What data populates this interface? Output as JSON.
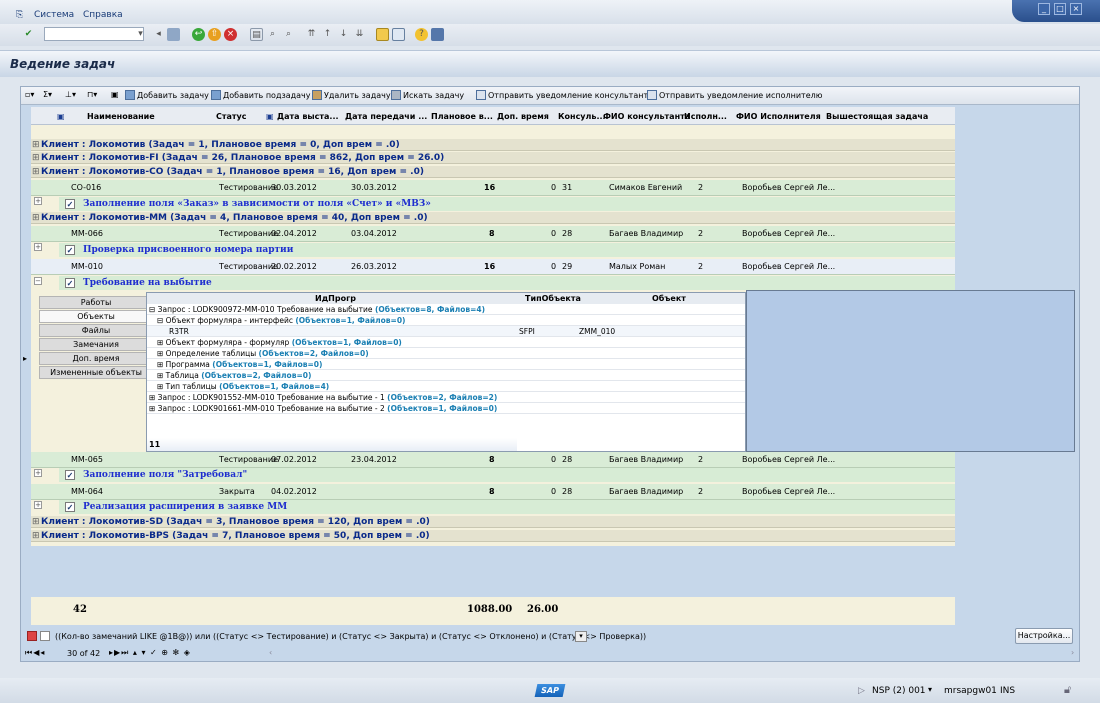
{
  "menu": {
    "items": [
      "Система",
      "Справка"
    ]
  },
  "page_title": "Ведение задач",
  "alv_toolbar": {
    "buttons": [
      "Добавить задачу",
      "Добавить подзадачу",
      "Удалить задачу",
      "Искать задачу",
      "Отправить уведомление консультанту",
      "Отправить уведомление исполнителю"
    ]
  },
  "columns": [
    "Наименование",
    "Статус",
    "Дата выста...",
    "Дата передачи ...",
    "Плановое в...",
    "Доп. время",
    "Консуль...",
    "ФИО консультанта",
    "Исполн...",
    "ФИО Исполнителя",
    "Вышестоящая задача"
  ],
  "groups": [
    "Клиент : Локомотив (Задач = 1, Плановое время = 0, Доп врем = .0)",
    "Клиент : Локомотив-FI (Задач = 26, Плановое время = 862, Доп врем = 26.0)",
    "Клиент : Локомотив-CO (Задач = 1, Плановое время = 16, Доп врем = .0)",
    "Клиент : Локомотив-MM (Задач = 4, Плановое время = 40, Доп врем = .0)",
    "Клиент : Локомотив-SD (Задач = 3, Плановое время = 120, Доп врем = .0)",
    "Клиент : Локомотив-BPS (Задач = 7, Плановое время = 50, Доп врем = .0)"
  ],
  "rows": [
    {
      "id": "CO-016",
      "status": "Тестирование",
      "date1": "30.03.2012",
      "date2": "30.03.2012",
      "plan": "16",
      "extra": "0",
      "cons": "31",
      "cons_name": "Симаков Евгений",
      "exec": "2",
      "exec_name": "Воробьев Сергей Ле...",
      "task": "Заполнение поля «Заказ» в зависимости от поля «Счет» и «МВЗ»"
    },
    {
      "id": "MM-066",
      "status": "Тестирование",
      "date1": "02.04.2012",
      "date2": "03.04.2012",
      "plan": "8",
      "extra": "0",
      "cons": "28",
      "cons_name": "Багаев Владимир",
      "exec": "2",
      "exec_name": "Воробьев Сергей Ле...",
      "task": "Проверка присвоенного номера партии"
    },
    {
      "id": "MM-010",
      "status": "Тестирование",
      "date1": "20.02.2012",
      "date2": "26.03.2012",
      "plan": "16",
      "extra": "0",
      "cons": "29",
      "cons_name": "Малых Роман",
      "exec": "2",
      "exec_name": "Воробьев Сергей Ле...",
      "task": "Требование на выбытие"
    },
    {
      "id": "MM-065",
      "status": "Тестирование",
      "date1": "07.02.2012",
      "date2": "23.04.2012",
      "plan": "8",
      "extra": "0",
      "cons": "28",
      "cons_name": "Багаев Владимир",
      "exec": "2",
      "exec_name": "Воробьев Сергей Ле...",
      "task": "Заполнение поля \"Затребовал\""
    },
    {
      "id": "MM-064",
      "status": "Закрыта",
      "date1": "04.02.2012",
      "date2": "",
      "plan": "8",
      "extra": "0",
      "cons": "28",
      "cons_name": "Багаев Владимир",
      "exec": "2",
      "exec_name": "Воробьев Сергей Ле...",
      "task": "Реализация расширения в заявке MM"
    }
  ],
  "detail": {
    "tabs": [
      "Работы",
      "Объекты",
      "Файлы",
      "Замечания",
      "Доп. время",
      "Измененные объекты"
    ],
    "tree_headers": [
      "ИдПрогр",
      "ТипОбъекта",
      "Объект"
    ],
    "tree": [
      {
        "text": "Запрос : LODK900972-MM-010 Требование на выбытие",
        "cnt": "(Объектов=8, Файлов=4)"
      },
      {
        "text": "Объект формуляра - интерфейс",
        "cnt": "(Объектов=1, Файлов=0)"
      },
      {
        "text": "R3TR",
        "c2": "SFPI",
        "c3": "ZMM_010"
      },
      {
        "text": "Объект формуляра - формуляр",
        "cnt": "(Объектов=1, Файлов=0)"
      },
      {
        "text": "Определение таблицы",
        "cnt": "(Объектов=2, Файлов=0)"
      },
      {
        "text": "Программа",
        "cnt": "(Объектов=1, Файлов=0)"
      },
      {
        "text": "Таблица",
        "cnt": "(Объектов=2, Файлов=0)"
      },
      {
        "text": "Тип таблицы",
        "cnt": "(Объектов=1, Файлов=4)"
      },
      {
        "text": "Запрос : LODK901552-MM-010 Требование на выбытие - 1",
        "cnt": "(Объектов=2, Файлов=2)"
      },
      {
        "text": "Запрос : LODK901661-MM-010 Требование на выбытие - 2",
        "cnt": "(Объектов=1, Файлов=0)"
      }
    ],
    "footer": "11"
  },
  "totals": {
    "count": "42",
    "plan": "1088.00",
    "extra": "26.00"
  },
  "filter": {
    "text": "((Кол-во замечаний LIKE @1B@)) или ((Статус <> Тестирование) и (Статус <> Закрыта) и (Статус <> Отклонено) и (Статус <> Проверка))",
    "button": "Настройка..."
  },
  "nav": {
    "position": "30 of 42"
  },
  "status": {
    "system": "NSP (2) 001",
    "server": "mrsapgw01",
    "mode": "INS",
    "logo": "SAP"
  }
}
